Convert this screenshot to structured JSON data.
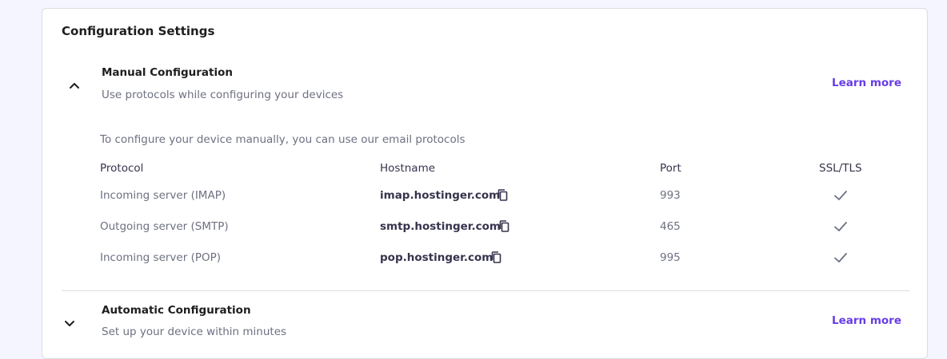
{
  "card": {
    "title": "Configuration Settings"
  },
  "manual": {
    "title": "Manual Configuration",
    "subtitle": "Use protocols while configuring your devices",
    "learn_more": "Learn more",
    "expanded": true,
    "intro": "To configure your device manually, you can use our email protocols",
    "columns": {
      "protocol": "Protocol",
      "hostname": "Hostname",
      "port": "Port",
      "ssl": "SSL/TLS"
    },
    "rows": [
      {
        "protocol": "Incoming server (IMAP)",
        "hostname": "imap.hostinger.com",
        "port": "993",
        "ssl": true
      },
      {
        "protocol": "Outgoing server (SMTP)",
        "hostname": "smtp.hostinger.com",
        "port": "465",
        "ssl": true
      },
      {
        "protocol": "Incoming server (POP)",
        "hostname": "pop.hostinger.com",
        "port": "995",
        "ssl": true
      }
    ]
  },
  "automatic": {
    "title": "Automatic Configuration",
    "subtitle": "Set up your device within minutes",
    "learn_more": "Learn more",
    "expanded": false
  },
  "colors": {
    "accent": "#673de6",
    "heading": "#1d1e20",
    "muted": "#6d7081",
    "border": "#dadce0"
  },
  "icons": {
    "collapse": "chevron-up-icon",
    "expand": "chevron-down-icon",
    "copy": "copy-icon",
    "check": "checkmark-icon"
  }
}
